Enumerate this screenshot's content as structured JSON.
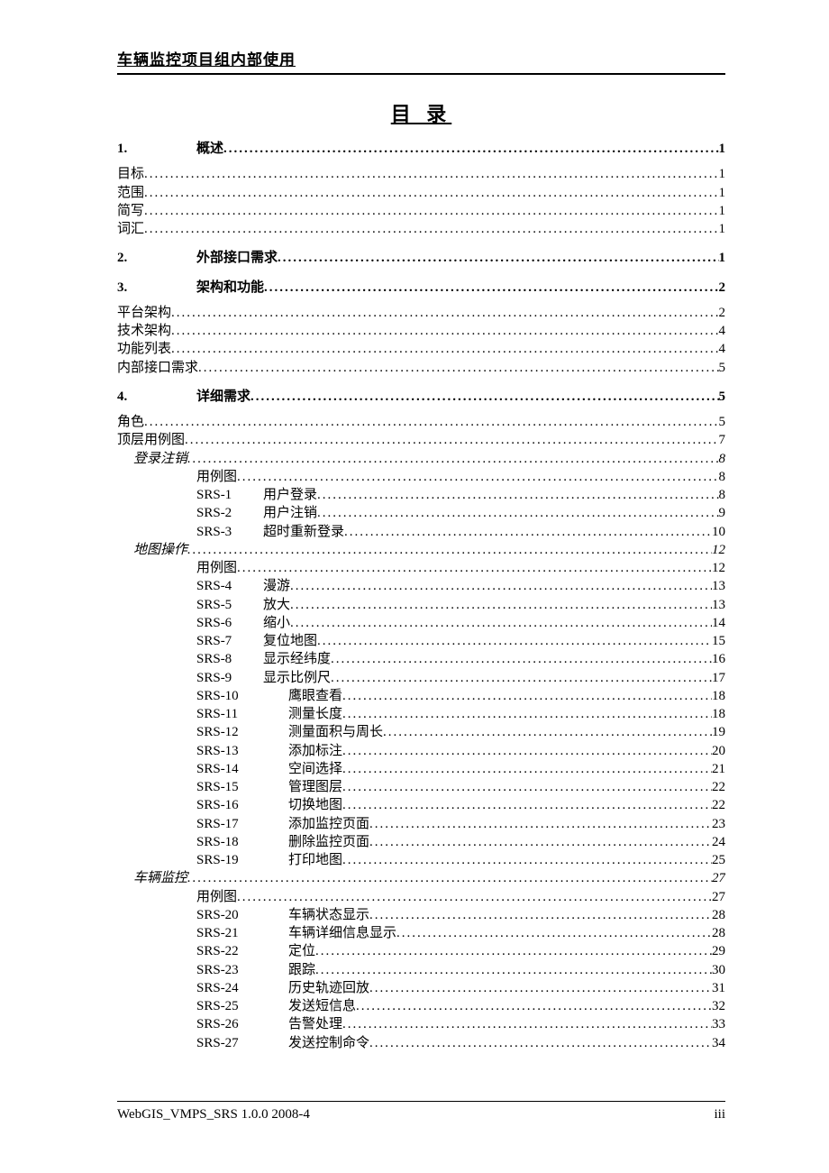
{
  "header": "车辆监控项目组内部使用",
  "title": "目 录",
  "footer_left": "WebGIS_VMPS_SRS 1.0.0 2008-4",
  "footer_right": "iii",
  "s1": {
    "num": "1.",
    "label": "概述",
    "pg": "1"
  },
  "s1_1": {
    "label": "目标",
    "pg": "1"
  },
  "s1_2": {
    "label": "范围",
    "pg": "1"
  },
  "s1_3": {
    "label": "简写",
    "pg": "1"
  },
  "s1_4": {
    "label": "词汇",
    "pg": "1"
  },
  "s2": {
    "num": "2.",
    "label": "外部接口需求",
    "pg": "1"
  },
  "s3": {
    "num": "3.",
    "label": "架构和功能",
    "pg": "2"
  },
  "s3_1": {
    "label": "平台架构",
    "pg": "2"
  },
  "s3_2": {
    "label": "技术架构",
    "pg": "4"
  },
  "s3_3": {
    "label": "功能列表",
    "pg": "4"
  },
  "s3_4": {
    "label": "内部接口需求",
    "pg": "5"
  },
  "s4": {
    "num": "4.",
    "label": "详细需求",
    "pg": "5"
  },
  "s4_1": {
    "label": "角色",
    "pg": "5"
  },
  "s4_2": {
    "label": "顶层用例图",
    "pg": "7"
  },
  "g1": {
    "label": "登录注销",
    "pg": "8"
  },
  "g1_uc": {
    "label": "用例图",
    "pg": "8"
  },
  "srs1": {
    "id": "SRS-1",
    "label": "用户登录",
    "pg": "8"
  },
  "srs2": {
    "id": "SRS-2",
    "label": "用户注销",
    "pg": "9"
  },
  "srs3": {
    "id": "SRS-3",
    "label": "超时重新登录",
    "pg": "10"
  },
  "g2": {
    "label": "地图操作",
    "pg": "12"
  },
  "g2_uc": {
    "label": "用例图",
    "pg": "12"
  },
  "srs4": {
    "id": "SRS-4",
    "label": "漫游",
    "pg": "13"
  },
  "srs5": {
    "id": "SRS-5",
    "label": "放大",
    "pg": "13"
  },
  "srs6": {
    "id": "SRS-6",
    "label": "缩小",
    "pg": "14"
  },
  "srs7": {
    "id": "SRS-7",
    "label": "复位地图",
    "pg": "15"
  },
  "srs8": {
    "id": "SRS-8",
    "label": "显示经纬度",
    "pg": "16"
  },
  "srs9": {
    "id": "SRS-9",
    "label": "显示比例尺",
    "pg": "17"
  },
  "srs10": {
    "id": "SRS-10",
    "label": "鹰眼查看",
    "pg": "18"
  },
  "srs11": {
    "id": "SRS-11",
    "label": "测量长度",
    "pg": "18"
  },
  "srs12": {
    "id": "SRS-12",
    "label": "测量面积与周长",
    "pg": "19"
  },
  "srs13": {
    "id": "SRS-13",
    "label": "添加标注",
    "pg": "20"
  },
  "srs14": {
    "id": "SRS-14",
    "label": "空间选择",
    "pg": "21"
  },
  "srs15": {
    "id": "SRS-15",
    "label": "管理图层",
    "pg": "22"
  },
  "srs16": {
    "id": "SRS-16",
    "label": "切换地图",
    "pg": "22"
  },
  "srs17": {
    "id": "SRS-17",
    "label": "添加监控页面",
    "pg": "23"
  },
  "srs18": {
    "id": "SRS-18",
    "label": "删除监控页面",
    "pg": "24"
  },
  "srs19": {
    "id": "SRS-19",
    "label": "打印地图",
    "pg": "25"
  },
  "g3": {
    "label": "车辆监控",
    "pg": "27"
  },
  "g3_uc": {
    "label": "用例图",
    "pg": "27"
  },
  "srs20": {
    "id": "SRS-20",
    "label": "车辆状态显示",
    "pg": "28"
  },
  "srs21": {
    "id": "SRS-21",
    "label": "车辆详细信息显示",
    "pg": "28"
  },
  "srs22": {
    "id": "SRS-22",
    "label": "定位",
    "pg": "29"
  },
  "srs23": {
    "id": "SRS-23",
    "label": "跟踪",
    "pg": "30"
  },
  "srs24": {
    "id": "SRS-24",
    "label": "历史轨迹回放",
    "pg": "31"
  },
  "srs25": {
    "id": "SRS-25",
    "label": "发送短信息",
    "pg": "32"
  },
  "srs26": {
    "id": "SRS-26",
    "label": "告警处理",
    "pg": "33"
  },
  "srs27": {
    "id": "SRS-27",
    "label": "发送控制命令",
    "pg": "34"
  }
}
